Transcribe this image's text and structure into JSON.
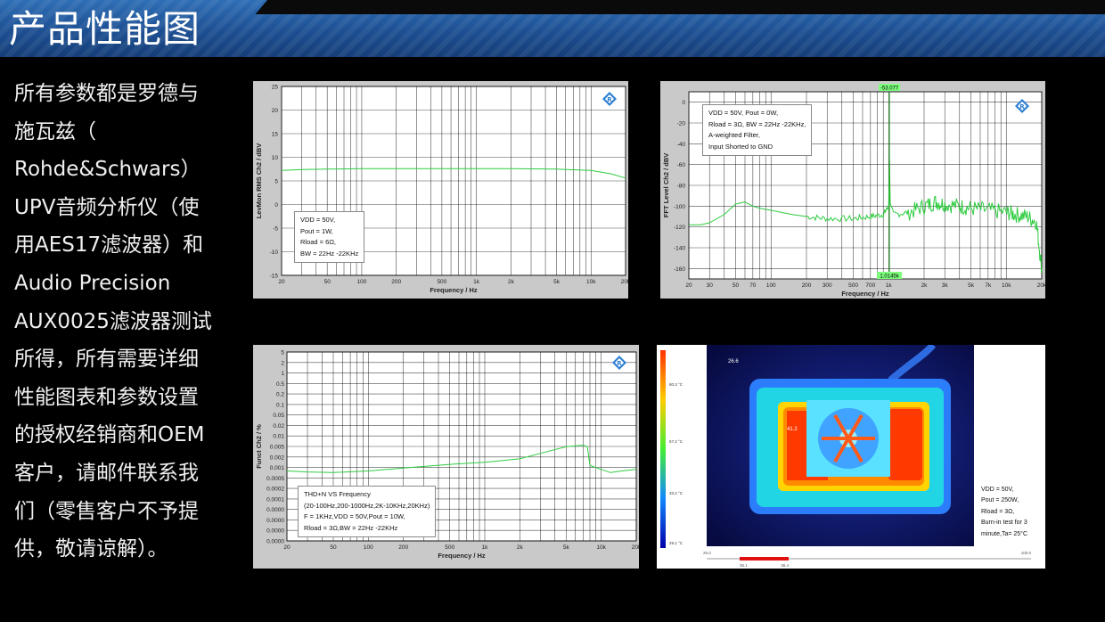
{
  "header": {
    "title": "产品性能图"
  },
  "description": [
    "所有参数都是罗德与",
    "施瓦兹（",
    "Rohde&Schwars）",
    "UPV音频分析仪（使",
    "用AES17滤波器）和",
    "Audio Precision",
    "AUX0025滤波器测试",
    "所得，所有需要详细",
    "性能图表和参数设置",
    "的授权经销商和OEM",
    "客户，请邮件联系我",
    "们（零售客户不予提",
    "供，敬请谅解）。"
  ],
  "colors": {
    "banner": "#1d4f92",
    "trace": "#2ecc40",
    "plot_bg": "#ffffff",
    "grid": "#333333",
    "panel_bg": "#c9c9c9"
  },
  "chart_data": [
    {
      "type": "line",
      "ylabel": "LevMon RMS Ch2 / dBV",
      "xlabel": "Frequency / Hz",
      "xscale": "log",
      "xlim": [
        20,
        20000
      ],
      "ylim": [
        -15,
        25
      ],
      "xticks": [
        20,
        50,
        100,
        200,
        500,
        1000,
        2000,
        5000,
        10000,
        20000
      ],
      "xtick_labels": [
        "20",
        "50",
        "100",
        "200",
        "500",
        "1k",
        "2k",
        "5k",
        "10k",
        "20k"
      ],
      "yticks": [
        -15,
        -10,
        -5,
        0,
        5,
        10,
        15,
        20,
        25
      ],
      "ytick_labels": [
        "-15",
        "-10",
        "-5",
        "0",
        "5",
        "10",
        "15",
        "20",
        "25"
      ],
      "grid": true,
      "annotation": [
        "VDD = 50V,",
        "Pout = 1W,",
        "Rload = 6Ω,",
        "BW = 22Hz -22KHz"
      ],
      "series": [
        {
          "x": [
            20,
            30,
            50,
            100,
            200,
            500,
            1000,
            2000,
            5000,
            10000,
            15000,
            20000
          ],
          "y": [
            7.2,
            7.4,
            7.5,
            7.6,
            7.6,
            7.6,
            7.6,
            7.6,
            7.5,
            7.2,
            6.5,
            5.6
          ]
        }
      ]
    },
    {
      "type": "line",
      "ylabel": "FFT Level Ch2 / dBV",
      "xlabel": "Frequency / Hz",
      "xscale": "log",
      "xlim": [
        20,
        20000
      ],
      "ylim": [
        -170,
        10
      ],
      "xticks": [
        20,
        30,
        50,
        70,
        100,
        200,
        300,
        500,
        700,
        1000,
        2000,
        3000,
        5000,
        7000,
        10000,
        20000
      ],
      "xtick_labels": [
        "20",
        "30",
        "50",
        "70",
        "100",
        "200",
        "300",
        "500",
        "700",
        "1k",
        "2k",
        "3k",
        "5k",
        "7k",
        "10k",
        "20k"
      ],
      "yticks": [
        0,
        -20,
        -40,
        -60,
        -80,
        -100,
        -120,
        -140,
        -160
      ],
      "ytick_labels": [
        "0",
        "-20",
        "-40",
        "-60",
        "-80",
        "-100",
        "-120",
        "-140",
        "-160"
      ],
      "grid": true,
      "marker_top_label": "-53.077",
      "marker_bottom_label": "1.0145k",
      "marker_x": 1014.5,
      "annotation": [
        "VDD = 50V, Pout = 0W,",
        "Rload = 3Ω, BW = 22Hz -22KHz,",
        "A-weighted Filter,",
        "Input Shorted to GND"
      ],
      "series": [
        {
          "x": [
            20,
            25,
            30,
            40,
            50,
            60,
            70,
            80,
            100,
            150,
            200,
            300,
            500,
            700,
            900,
            1000,
            1014.5,
            1030,
            1100,
            1500,
            2000,
            2500,
            3000,
            4000,
            5000,
            7000,
            10000,
            12000,
            15000,
            18000,
            20000
          ],
          "y": [
            -118,
            -118,
            -116,
            -108,
            -98,
            -96,
            -100,
            -102,
            -104,
            -108,
            -110,
            -112,
            -112,
            -110,
            -108,
            -100,
            -53,
            -100,
            -108,
            -106,
            -100,
            -96,
            -98,
            -100,
            -102,
            -104,
            -106,
            -108,
            -110,
            -115,
            -160
          ]
        }
      ]
    },
    {
      "type": "line",
      "ylabel": "Funct Ch2 / %",
      "xlabel": "Frequency / Hz",
      "xscale": "log",
      "yscale": "log",
      "xlim": [
        20,
        20000
      ],
      "ylim": [
        0.0001,
        5
      ],
      "xticks": [
        20,
        50,
        100,
        200,
        500,
        1000,
        2000,
        5000,
        10000,
        20000
      ],
      "xtick_labels": [
        "20",
        "50",
        "100",
        "200",
        "500",
        "1k",
        "2k",
        "5k",
        "10k",
        "20k"
      ],
      "yticks": [
        5,
        2,
        1,
        0.5,
        0.2,
        0.1,
        0.05,
        0.02,
        0.01,
        0.005,
        0.002,
        0.001,
        0.0005,
        0.0002,
        0.0001
      ],
      "ytick_labels": [
        "5",
        "2",
        "1",
        "0.5",
        "0.2",
        "0.1",
        "0.05",
        "0.02",
        "0.01",
        "0.005",
        "0.002",
        "0.001",
        "0.0005",
        "0.0002",
        "0.0001",
        "0.0000",
        "0.0000",
        "0.0000",
        "0.0000"
      ],
      "grid": true,
      "annotation": [
        "THD+N VS  Frequency",
        "(20-100Hz,200-1000Hz,2K-10KHz,20KHz)",
        "F = 1KHz,VDD = 50V,Pout = 10W,",
        "Rload = 3Ω,BW = 22Hz -22KHz"
      ],
      "series": [
        {
          "x": [
            20,
            30,
            50,
            100,
            200,
            500,
            1000,
            2000,
            3000,
            5000,
            7000,
            7600,
            8000,
            10000,
            12000,
            15000,
            20000
          ],
          "y": [
            0.0055,
            0.0052,
            0.005,
            0.0055,
            0.0065,
            0.008,
            0.009,
            0.011,
            0.015,
            0.022,
            0.024,
            0.022,
            0.0075,
            0.006,
            0.005,
            0.0055,
            0.006
          ]
        }
      ]
    }
  ],
  "thermal": {
    "max_label": "26.6",
    "spot_label": "41.2",
    "scale_labels": [
      "80.3 °C",
      "57.2 °C",
      "33.2 °C",
      "29.1 °C"
    ],
    "range_left": "25.0",
    "range_right": "100.0",
    "range_low": "35.1",
    "range_high": "36.4",
    "notes": [
      "VDD = 50V,",
      "Pout = 250W,",
      "Rload = 3Ω,",
      "Burn-in test for 3",
      "minute,Ta= 25°C"
    ]
  }
}
